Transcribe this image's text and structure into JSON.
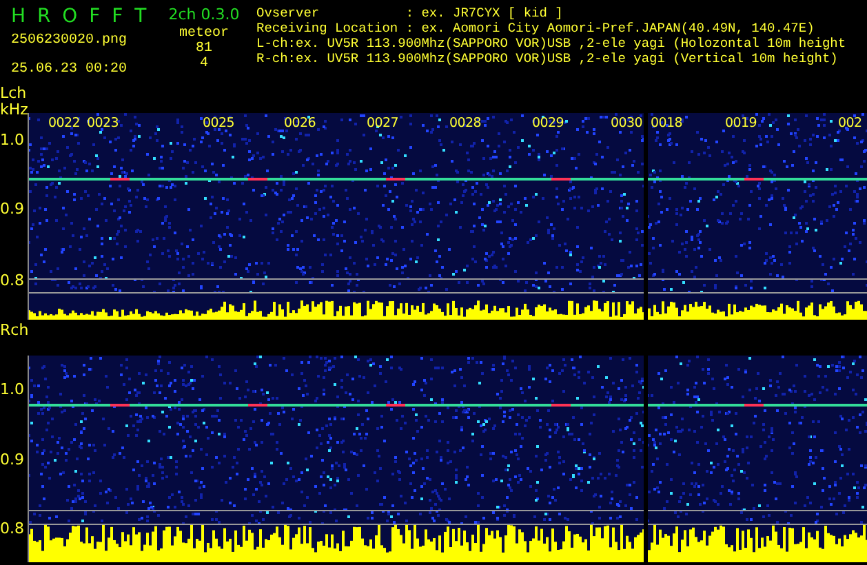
{
  "header": {
    "app_title": "H R O F F T",
    "version": "2ch 0.3.0",
    "filename": "2506230020.png",
    "datetime": "25.06.23 00:20",
    "meteor_label": "meteor",
    "counts": [
      "81",
      "4"
    ],
    "info_lines": [
      "Ovserver           : ex. JR7CYX [ kid ]",
      "Receiving Location : ex. Aomori City Aomori-Pref.JAPAN(40.49N, 140.47E)",
      "L-ch:ex. UV5R 113.900Mhz(SAPPORO VOR)USB ,2-ele yagi (Holozontal 10m height",
      "R-ch:ex. UV5R 113.900Mhz(SAPPORO VOR)USB ,2-ele yagi (Vertical 10m height)"
    ]
  },
  "channels": [
    {
      "name": "Lch",
      "unit": "kHz",
      "ticks": [
        "1.0",
        "0.9",
        "0.8"
      ],
      "time_labels": [
        "0022",
        "0023",
        "0025",
        "0026",
        "0027",
        "0028",
        "0029",
        "0030",
        "0018",
        "0019",
        "002"
      ]
    },
    {
      "name": "Rch",
      "ticks": [
        "1.0",
        "0.9",
        "0.8"
      ]
    }
  ]
}
